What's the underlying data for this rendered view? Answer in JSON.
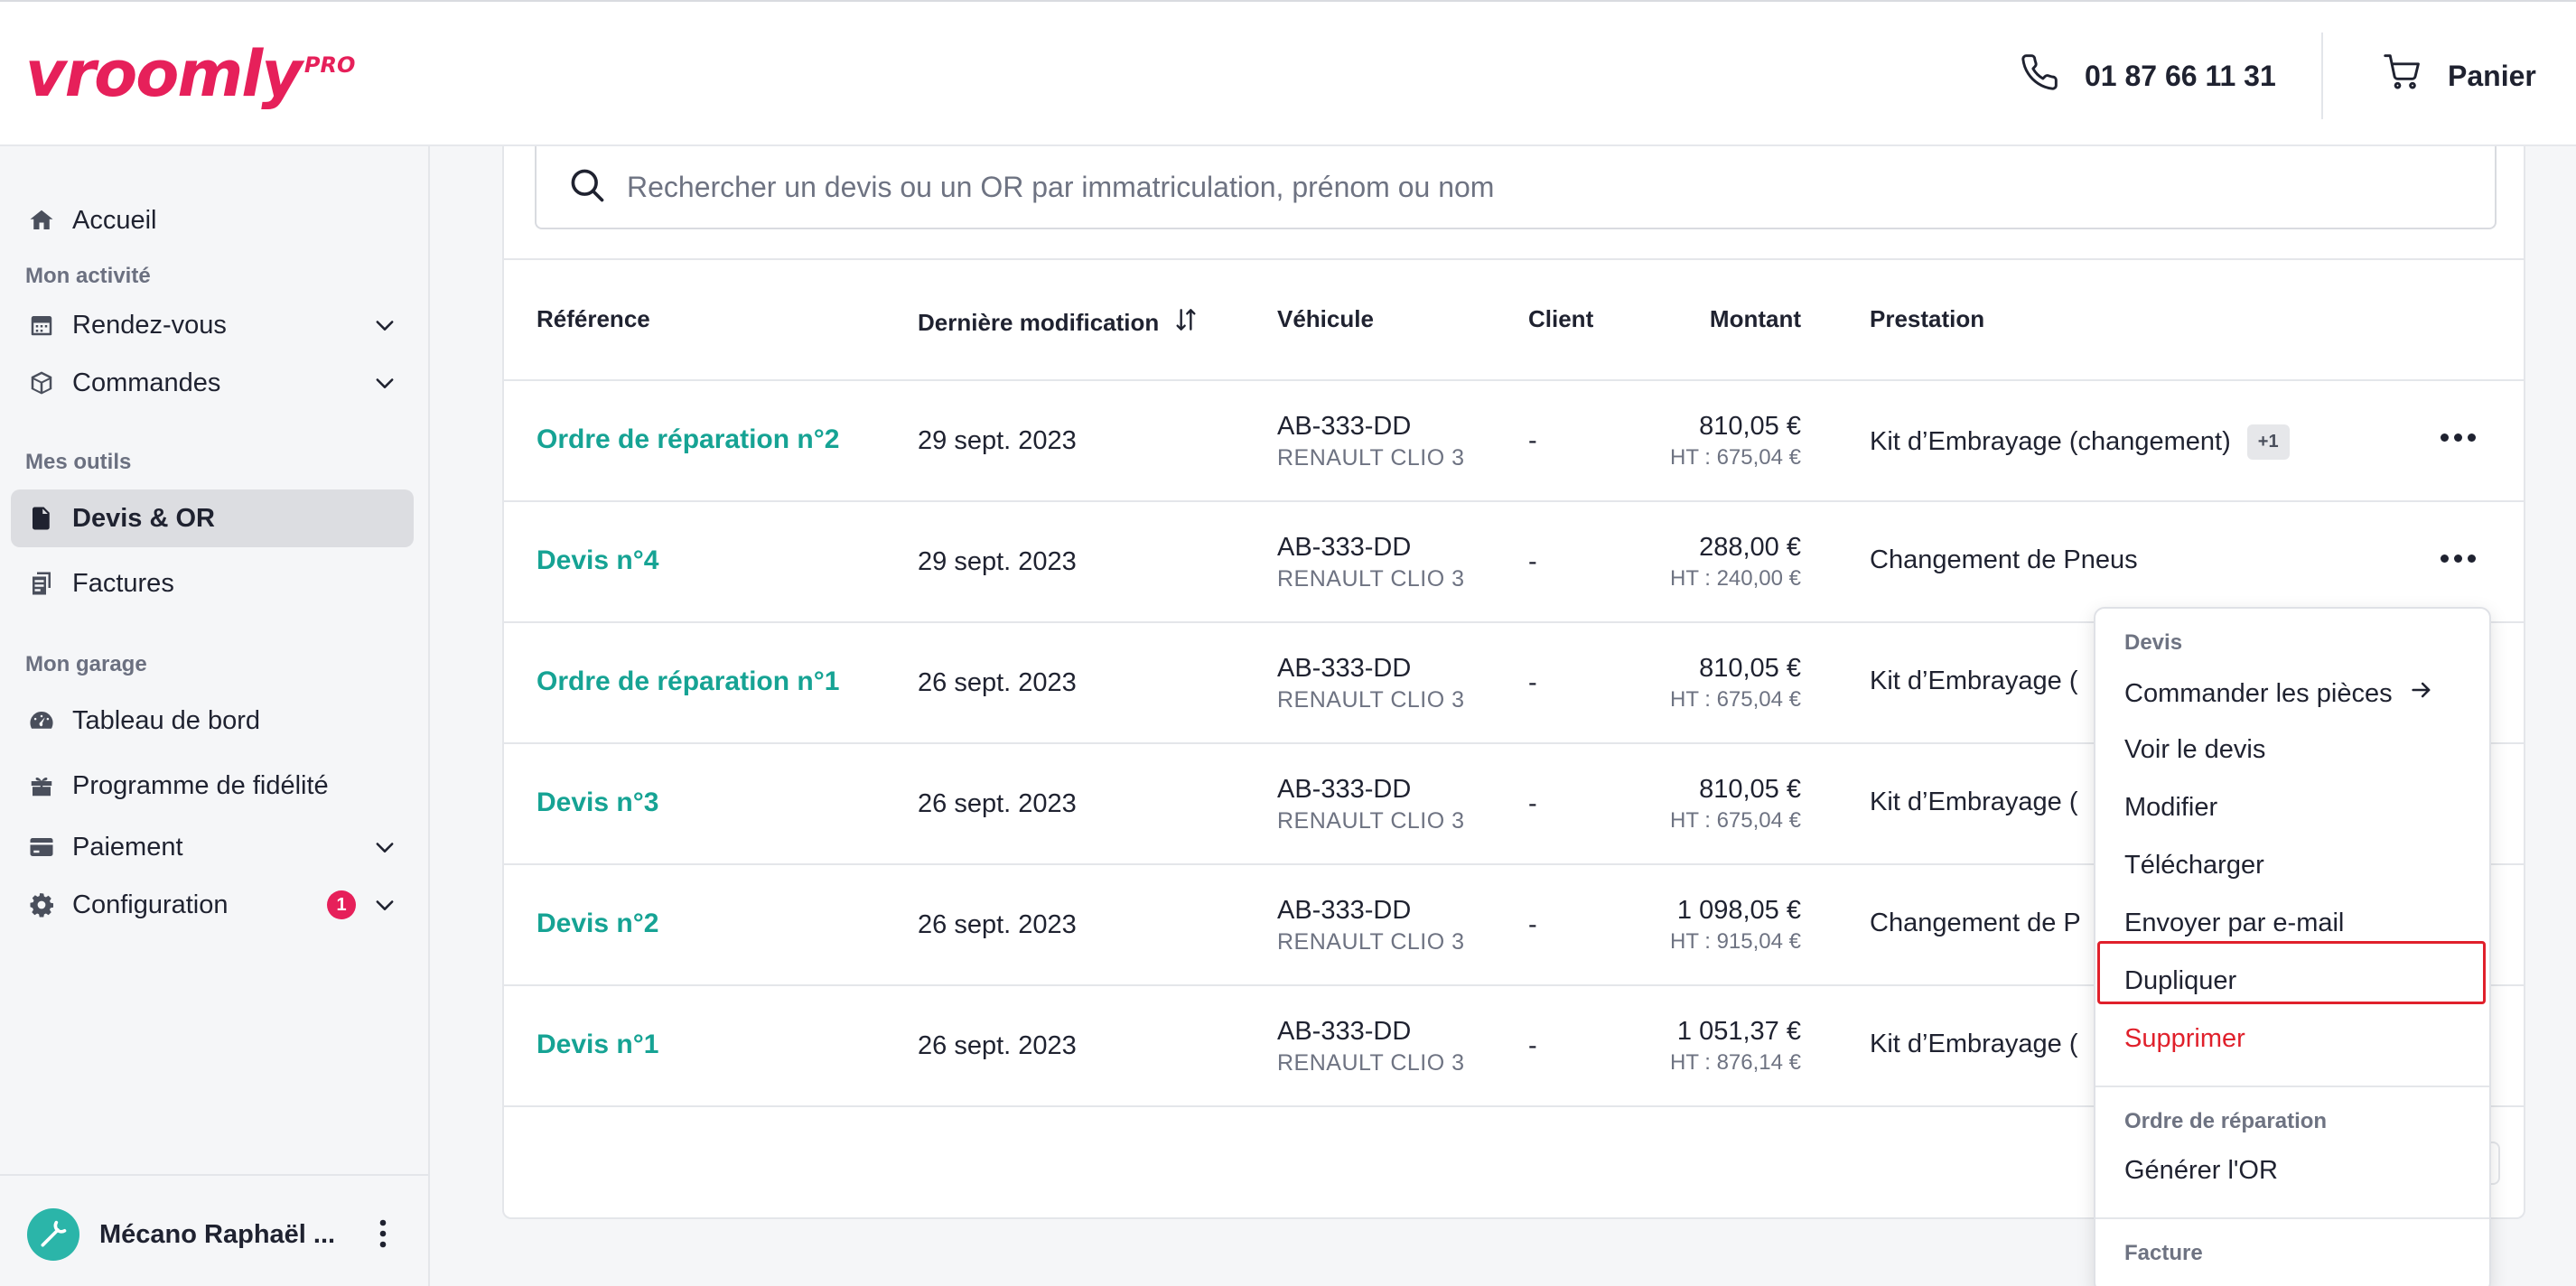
{
  "header": {
    "logo_text": "vroomly",
    "logo_suffix": "PRO",
    "phone": "01 87 66 11 31",
    "cart_label": "Panier"
  },
  "sidebar": {
    "home": "Accueil",
    "section_activity": "Mon activité",
    "appointments": "Rendez-vous",
    "orders": "Commandes",
    "section_tools": "Mes outils",
    "quotes": "Devis & OR",
    "invoices": "Factures",
    "section_garage": "Mon garage",
    "dashboard": "Tableau de bord",
    "loyalty": "Programme de fidélité",
    "payment": "Paiement",
    "configuration": "Configuration",
    "configuration_badge": "1",
    "user_name": "Mécano Raphaël ..."
  },
  "search": {
    "placeholder": "Rechercher un devis ou un OR par immatriculation, prénom ou nom"
  },
  "table": {
    "headers": {
      "reference": "Référence",
      "last_modified": "Dernière modification",
      "vehicle": "Véhicule",
      "client": "Client",
      "amount": "Montant",
      "service": "Prestation"
    },
    "rows": [
      {
        "reference": "Ordre de réparation n°2",
        "date": "29 sept. 2023",
        "plate": "AB-333-DD",
        "model": "RENAULT CLIO 3",
        "client": "-",
        "ttc": "810,05 €",
        "ht": "HT : 675,04 €",
        "service": "Kit d’Embrayage (changement)",
        "extra": "+1"
      },
      {
        "reference": "Devis n°4",
        "date": "29 sept. 2023",
        "plate": "AB-333-DD",
        "model": "RENAULT CLIO 3",
        "client": "-",
        "ttc": "288,00 €",
        "ht": "HT : 240,00 €",
        "service": "Changement de Pneus"
      },
      {
        "reference": "Ordre de réparation n°1",
        "date": "26 sept. 2023",
        "plate": "AB-333-DD",
        "model": "RENAULT CLIO 3",
        "client": "-",
        "ttc": "810,05 €",
        "ht": "HT : 675,04 €",
        "service": "Kit d’Embrayage ("
      },
      {
        "reference": "Devis n°3",
        "date": "26 sept. 2023",
        "plate": "AB-333-DD",
        "model": "RENAULT CLIO 3",
        "client": "-",
        "ttc": "810,05 €",
        "ht": "HT : 675,04 €",
        "service": "Kit d’Embrayage ("
      },
      {
        "reference": "Devis n°2",
        "date": "26 sept. 2023",
        "plate": "AB-333-DD",
        "model": "RENAULT CLIO 3",
        "client": "-",
        "ttc": "1 098,05 €",
        "ht": "HT : 915,04 €",
        "service": "Changement de P"
      },
      {
        "reference": "Devis n°1",
        "date": "26 sept. 2023",
        "plate": "AB-333-DD",
        "model": "RENAULT CLIO 3",
        "client": "-",
        "ttc": "1 051,37 €",
        "ht": "HT : 876,14 €",
        "service": "Kit d’Embrayage ("
      }
    ]
  },
  "menu": {
    "section_quote": "Devis",
    "order_parts": "Commander les pièces",
    "view_quote": "Voir le devis",
    "edit": "Modifier",
    "download": "Télécharger",
    "send_email": "Envoyer par e-mail",
    "duplicate": "Dupliquer",
    "delete": "Supprimer",
    "section_repair": "Ordre de réparation",
    "generate_or": "Générer l'OR",
    "section_invoice": "Facture"
  },
  "colors": {
    "brand": "#e6205a",
    "link": "#16a394",
    "danger": "#e0202b"
  }
}
